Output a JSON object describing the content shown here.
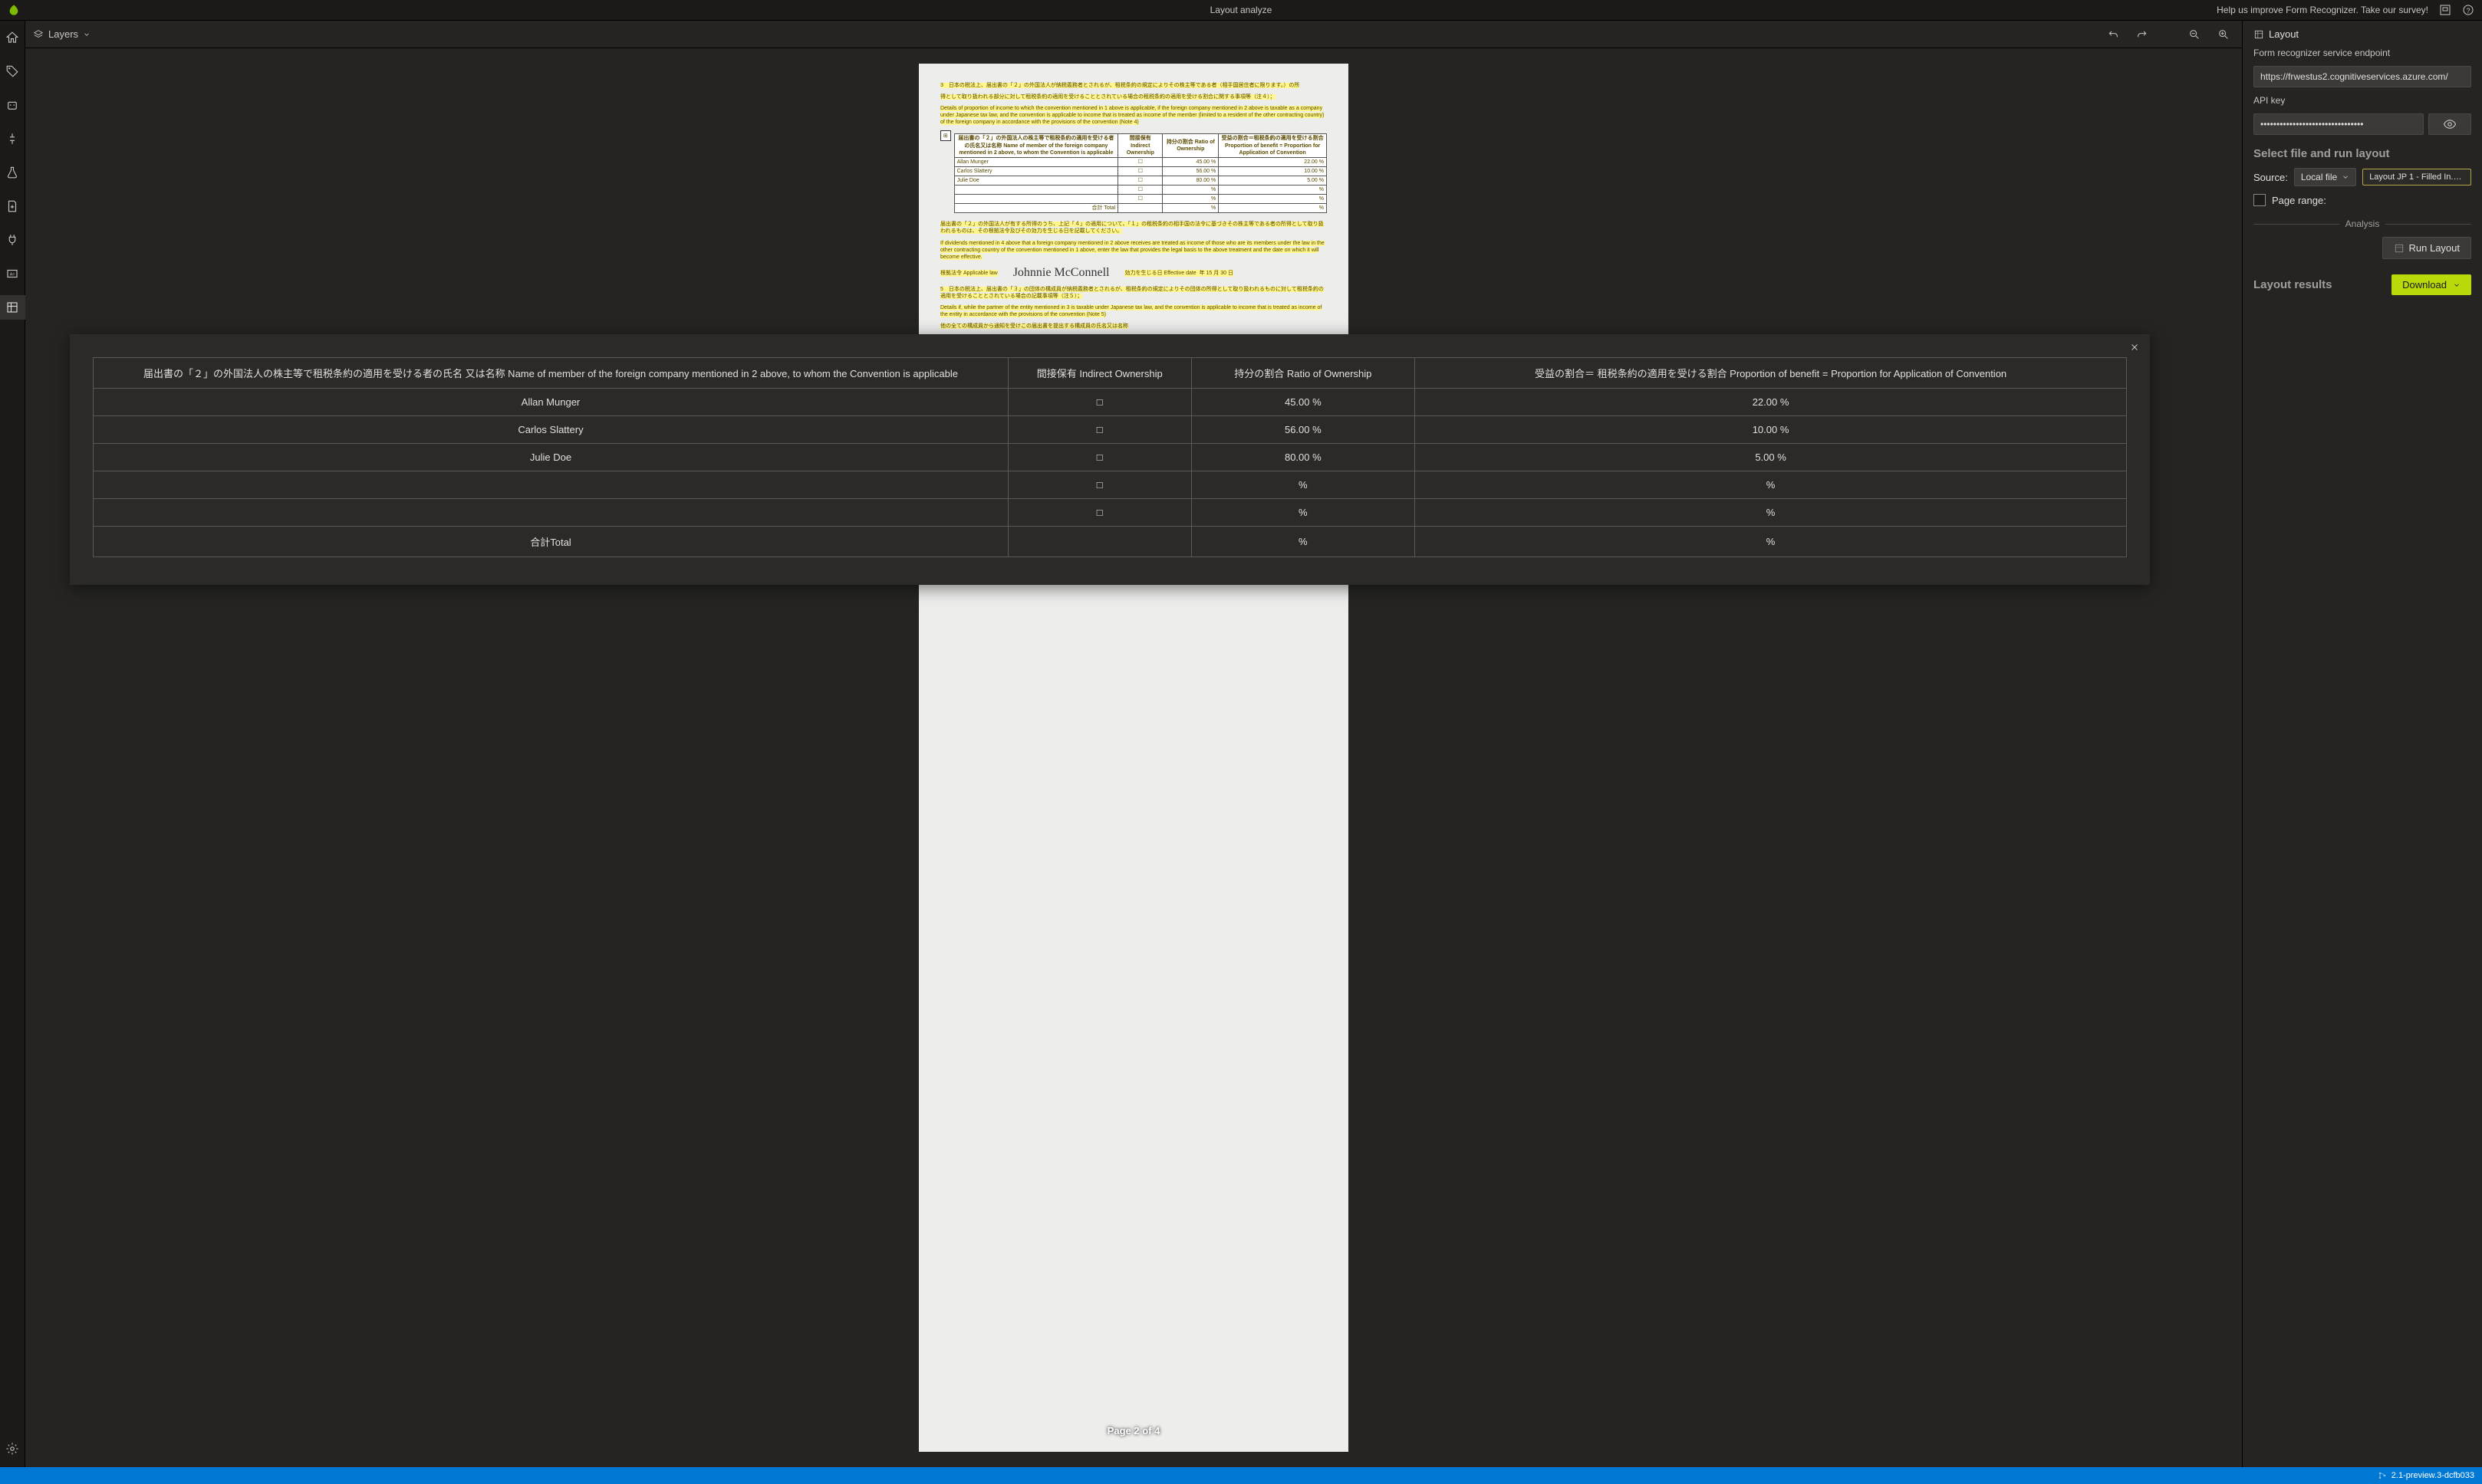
{
  "topbar": {
    "title": "Layout analyze",
    "survey_link": "Help us improve Form Recognizer. Take our survey!"
  },
  "toolbar": {
    "layers_label": "Layers"
  },
  "rightpanel": {
    "layout_label": "Layout",
    "endpoint_label": "Form recognizer service endpoint",
    "endpoint_value": "https://frwestus2.cognitiveservices.azure.com/",
    "apikey_label": "API key",
    "apikey_value": "••••••••••••••••••••••••••••••••",
    "select_file_heading": "Select file and run layout",
    "source_label": "Source:",
    "source_dropdown": "Local file",
    "file_name": "Layout JP 1 - Filled In.pdf",
    "page_range_label": "Page range:",
    "analysis_label": "Analysis",
    "run_button": "Run Layout",
    "results_heading": "Layout results",
    "download_button": "Download"
  },
  "document": {
    "pager": "Page 2 of 4",
    "signature": "Johnnie McConnell",
    "form_rows": [
      {
        "name": "Allan Munger",
        "ratio": "45.00",
        "benefit": "22.00"
      },
      {
        "name": "Carlos Slattery",
        "ratio": "56.00",
        "benefit": "10.00"
      },
      {
        "name": "Julie Doe",
        "ratio": "80.00",
        "benefit": "5.00"
      }
    ]
  },
  "overlay": {
    "headers": {
      "name": "届出書の「２」の外国法人の株主等で租税条約の適用を受ける者の氏名 又は名称 Name of member of the foreign company mentioned in 2 above, to whom the Convention is applicable",
      "indirect": "間接保有 Indirect Ownership",
      "ratio": "持分の割合 Ratio of Ownership",
      "benefit": "受益の割合＝ 租税条約の適用を受ける割合 Proportion of benefit = Proportion for Application of Convention"
    },
    "rows": [
      {
        "name": "Allan Munger",
        "indirect": "□",
        "ratio": "45.00 %",
        "benefit": "22.00 %"
      },
      {
        "name": "Carlos Slattery",
        "indirect": "□",
        "ratio": "56.00 %",
        "benefit": "10.00 %"
      },
      {
        "name": "Julie Doe",
        "indirect": "□",
        "ratio": "80.00 %",
        "benefit": "5.00 %"
      },
      {
        "name": "",
        "indirect": "□",
        "ratio": "%",
        "benefit": "%"
      },
      {
        "name": "",
        "indirect": "□",
        "ratio": "%",
        "benefit": "%"
      },
      {
        "name": "合計Total",
        "indirect": "",
        "ratio": "%",
        "benefit": "%"
      }
    ]
  },
  "statusbar": {
    "version": "2.1-preview.3-dcfb033"
  },
  "icons": {
    "logo": "leaf-icon",
    "home": "home-icon",
    "tag": "tag-icon",
    "robot": "robot-icon",
    "connect": "connector-icon",
    "train": "flask-icon",
    "newdoc": "new-document-icon",
    "plug": "plug-icon",
    "ocr": "ocr-icon",
    "layout": "layout-icon",
    "gear": "gear-icon"
  }
}
